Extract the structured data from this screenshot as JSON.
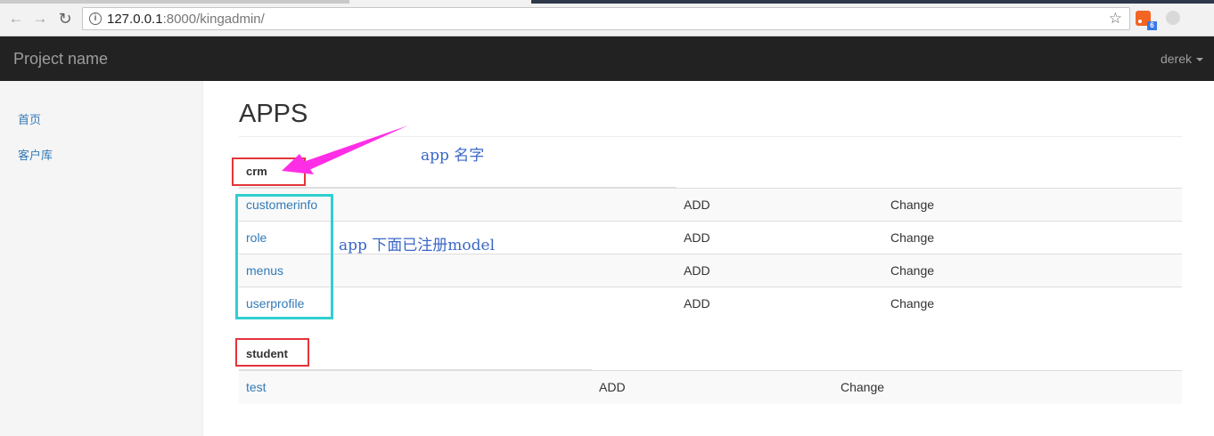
{
  "browser": {
    "url_host": "127.0.0.1",
    "url_rest": ":8000/kingadmin/",
    "ext_badge": "6"
  },
  "navbar": {
    "brand": "Project name",
    "user": "derek"
  },
  "sidebar": {
    "items": [
      {
        "label": "首页"
      },
      {
        "label": "客户库"
      }
    ]
  },
  "main": {
    "title": "APPS",
    "apps": [
      {
        "name": "crm",
        "models": [
          {
            "name": "customerinfo",
            "add": "ADD",
            "change": "Change"
          },
          {
            "name": "role",
            "add": "ADD",
            "change": "Change"
          },
          {
            "name": "menus",
            "add": "ADD",
            "change": "Change"
          },
          {
            "name": "userprofile",
            "add": "ADD",
            "change": "Change"
          }
        ]
      },
      {
        "name": "student",
        "models": [
          {
            "name": "test",
            "add": "ADD",
            "change": "Change"
          }
        ]
      }
    ]
  },
  "annotations": {
    "app_name_note": "app 名字",
    "models_note": "app 下面已注册model",
    "colors": {
      "red_box": "#e3343a",
      "cyan_box": "#2fcfd1",
      "arrow": "#ff2ee6",
      "note_text": "#3a67c7"
    }
  }
}
